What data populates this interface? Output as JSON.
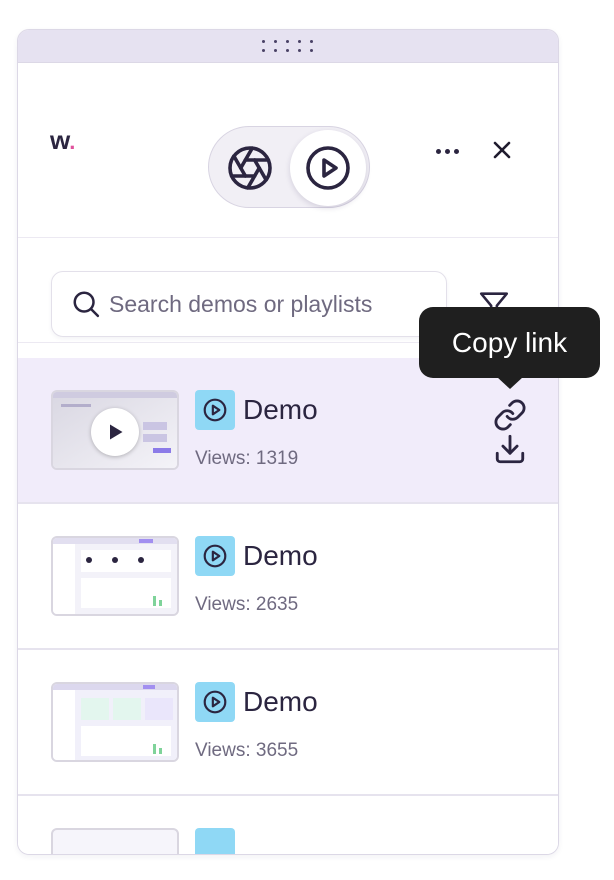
{
  "app": {
    "logo_text": "w",
    "logo_dot": "."
  },
  "header": {
    "mode_toggle": {
      "options": [
        "capture-icon",
        "play-icon"
      ],
      "selected": "play-icon"
    },
    "more_icon": "ellipsis-icon",
    "close_icon": "close-icon"
  },
  "search": {
    "placeholder": "Search demos or playlists",
    "value": "",
    "filter_icon": "filter-icon"
  },
  "tooltip": {
    "text": "Copy link"
  },
  "items": [
    {
      "title": "Demo",
      "views_label": "Views: 1319",
      "type_icon": "play-circle-icon",
      "active": true
    },
    {
      "title": "Demo",
      "views_label": "Views: 2635",
      "type_icon": "play-circle-icon",
      "active": false
    },
    {
      "title": "Demo",
      "views_label": "Views: 3655",
      "type_icon": "play-circle-icon",
      "active": false
    }
  ],
  "colors": {
    "accent_lavender": "#e6e2f1",
    "active_row": "#f1ecfa",
    "badge_blue": "#8fd8f5",
    "brand_pink": "#e0529c",
    "text_dark": "#2b2540",
    "text_muted": "#6f6a80",
    "tooltip_bg": "#1f1f1f"
  }
}
